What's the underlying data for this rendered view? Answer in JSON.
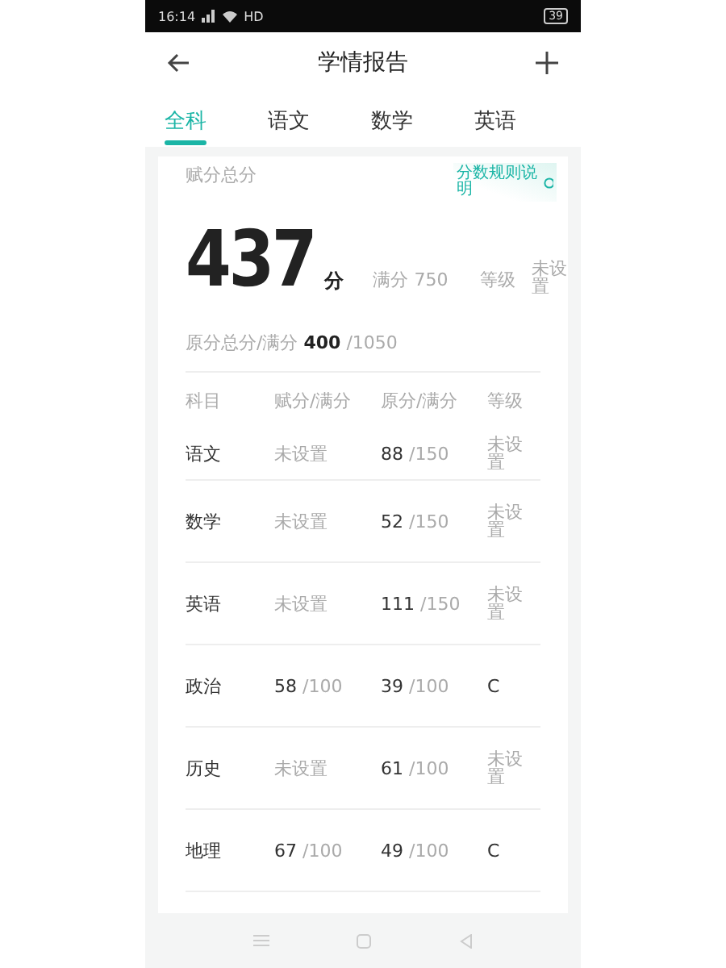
{
  "status_bar": {
    "time": "16:14",
    "network": "HD",
    "battery": "39"
  },
  "header": {
    "title": "学情报告"
  },
  "tabs": [
    {
      "label": "全科",
      "selected": true
    },
    {
      "label": "语文",
      "selected": false
    },
    {
      "label": "数学",
      "selected": false
    },
    {
      "label": "英语",
      "selected": false
    }
  ],
  "summary": {
    "label": "赋分总分",
    "rules_link": "分数规则说明",
    "score": "437",
    "unit": "分",
    "full_label": "满分 750",
    "grade_label": "等级",
    "grade_value": "未设置",
    "raw_label": "原分总分/满分",
    "raw_score": "400",
    "raw_full": "/1050"
  },
  "table": {
    "columns": [
      "科目",
      "赋分/满分",
      "原分/满分",
      "等级"
    ],
    "rows": [
      {
        "subject": "语文",
        "assigned": {
          "text": "未设置"
        },
        "raw": {
          "score": "88",
          "full": "/150"
        },
        "grade": "未设置"
      },
      {
        "subject": "数学",
        "assigned": {
          "text": "未设置"
        },
        "raw": {
          "score": "52",
          "full": "/150"
        },
        "grade": "未设置"
      },
      {
        "subject": "英语",
        "assigned": {
          "text": "未设置"
        },
        "raw": {
          "score": "111",
          "full": "/150"
        },
        "grade": "未设置"
      },
      {
        "subject": "政治",
        "assigned": {
          "score": "58",
          "full": "/100"
        },
        "raw": {
          "score": "39",
          "full": "/100"
        },
        "grade": "C"
      },
      {
        "subject": "历史",
        "assigned": {
          "text": "未设置"
        },
        "raw": {
          "score": "61",
          "full": "/100"
        },
        "grade": "未设置"
      },
      {
        "subject": "地理",
        "assigned": {
          "score": "67",
          "full": "/100"
        },
        "raw": {
          "score": "49",
          "full": "/100"
        },
        "grade": "C"
      }
    ]
  }
}
